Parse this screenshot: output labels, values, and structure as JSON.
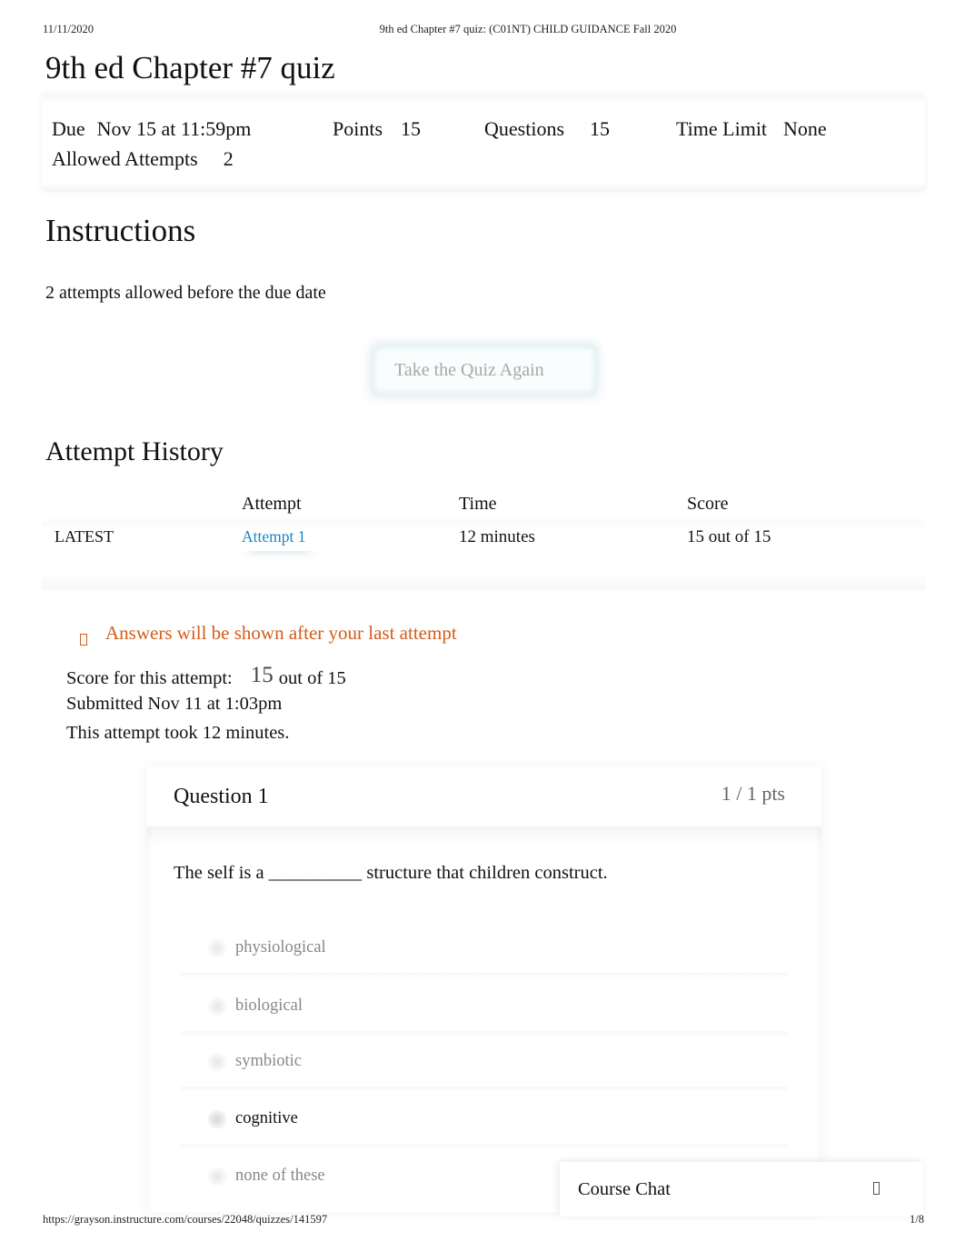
{
  "print_header": {
    "date": "11/11/2020",
    "title": "9th ed Chapter #7 quiz: (C01NT) CHILD GUIDANCE Fall 2020"
  },
  "quiz": {
    "title": "9th ed Chapter #7 quiz",
    "details": {
      "due_label": "Due",
      "due_value": "Nov 15 at 11:59pm",
      "points_label": "Points",
      "points_value": "15",
      "questions_label": "Questions",
      "questions_value": "15",
      "time_limit_label": "Time Limit",
      "time_limit_value": "None",
      "allowed_attempts_label": "Allowed Attempts",
      "allowed_attempts_value": "2"
    }
  },
  "instructions": {
    "heading": "Instructions",
    "text": "2 attempts allowed before the due date"
  },
  "take_quiz_button": "Take the Quiz Again",
  "attempt_history": {
    "heading": "Attempt History",
    "columns": [
      "",
      "Attempt",
      "Time",
      "Score"
    ],
    "rows": [
      {
        "label": "LATEST",
        "attempt": "Attempt 1",
        "time": "12 minutes",
        "score": "15 out of 15"
      }
    ]
  },
  "warning": {
    "icon": "warning-icon",
    "text": "Answers will be shown after your last attempt",
    "color": "#d35c1c"
  },
  "attempt_summary": {
    "score_label": "Score for this attempt:",
    "score_value": "15",
    "score_total": "out of 15",
    "submitted": "Submitted Nov 11 at 1:03pm",
    "duration": "This attempt took 12 minutes."
  },
  "question": {
    "title": "Question 1",
    "points": "1 / 1 pts",
    "text": "The self is a __________ structure that children construct.",
    "answers": [
      {
        "label": "physiological",
        "selected": false
      },
      {
        "label": "biological",
        "selected": false
      },
      {
        "label": "symbiotic",
        "selected": false
      },
      {
        "label": "cognitive",
        "selected": true
      },
      {
        "label": "none of these",
        "selected": false
      }
    ]
  },
  "course_chat": {
    "label": "Course Chat",
    "icon": "chat-expand-icon"
  },
  "print_footer": {
    "url": "https://grayson.instructure.com/courses/22048/quizzes/141597",
    "page": "1/8"
  },
  "colors": {
    "link": "#1a87c9",
    "warning": "#d35c1c"
  }
}
